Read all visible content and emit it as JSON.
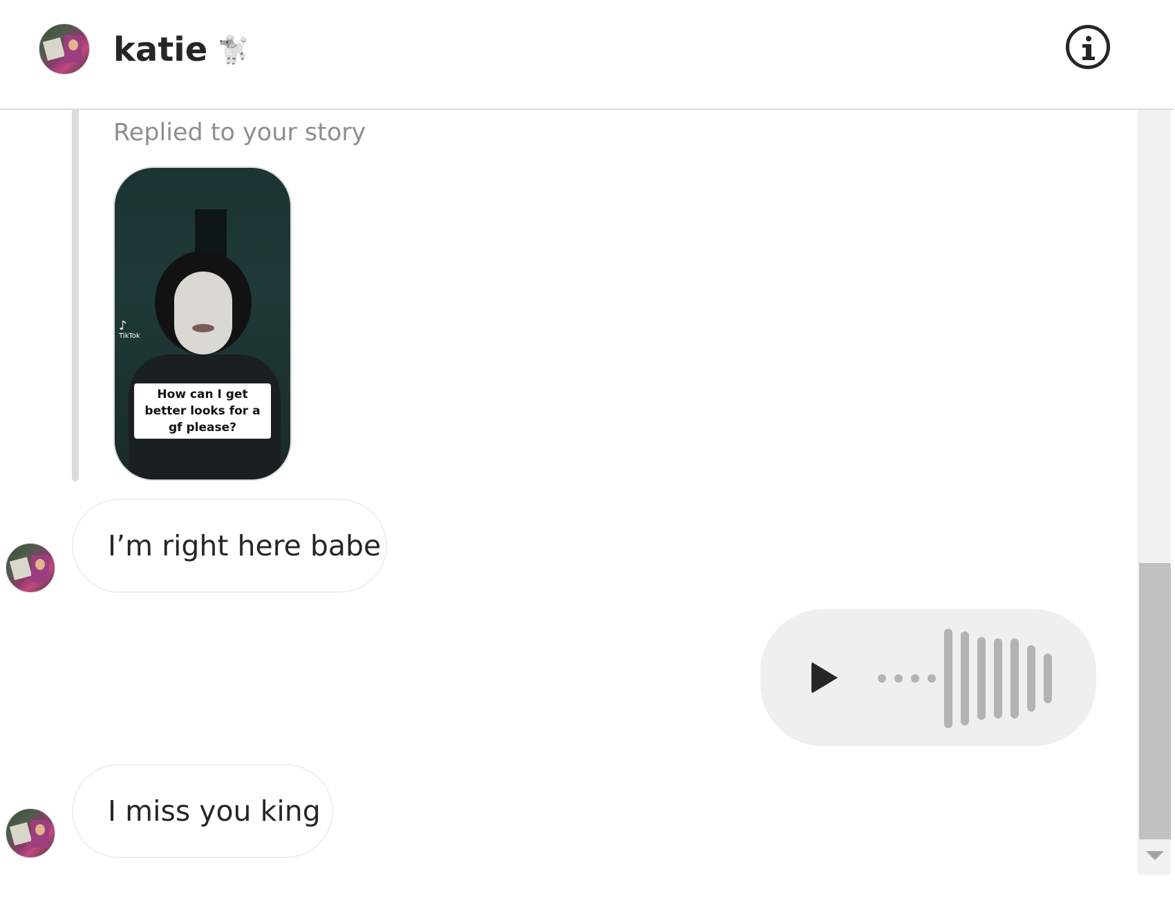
{
  "header": {
    "name": "katie",
    "emoji": "🐩",
    "info_icon": "info-icon"
  },
  "story_reply": {
    "label": "Replied to your story",
    "thumbnail": {
      "caption": "How can I get better looks for a gf please?",
      "watermark": "TikTok"
    }
  },
  "messages": [
    {
      "direction": "incoming",
      "type": "text",
      "text": "I’m right here babe"
    },
    {
      "direction": "outgoing",
      "type": "audio",
      "icon": "play-icon"
    },
    {
      "direction": "incoming",
      "type": "text",
      "text": "I miss you king"
    }
  ],
  "colors": {
    "divider": "#dbdbdb",
    "secondary_text": "#8e8e8e",
    "outgoing_bubble": "#efefef",
    "waveform": "#b3b3b3"
  }
}
